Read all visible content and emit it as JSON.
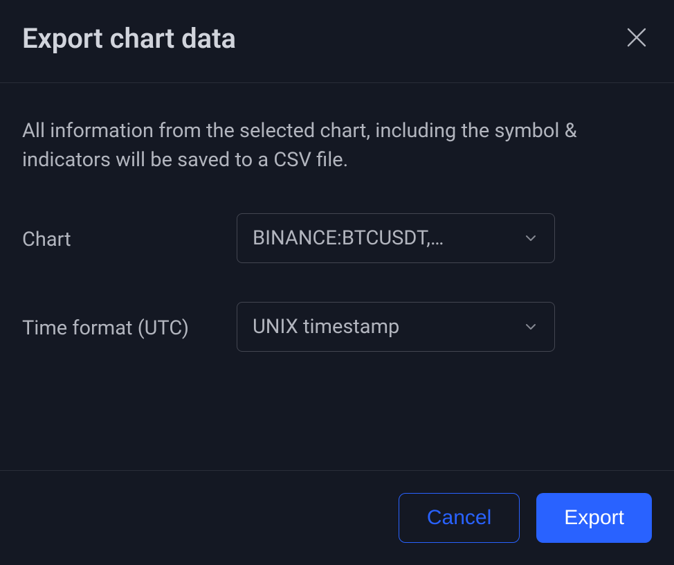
{
  "dialog": {
    "title": "Export chart data",
    "description": "All information from the selected chart, including the symbol & indicators will be saved to a CSV file.",
    "fields": {
      "chart": {
        "label": "Chart",
        "value": "BINANCE:BTCUSDT,…"
      },
      "time_format": {
        "label": "Time format (UTC)",
        "value": "UNIX timestamp"
      }
    },
    "actions": {
      "cancel": "Cancel",
      "export": "Export"
    }
  }
}
